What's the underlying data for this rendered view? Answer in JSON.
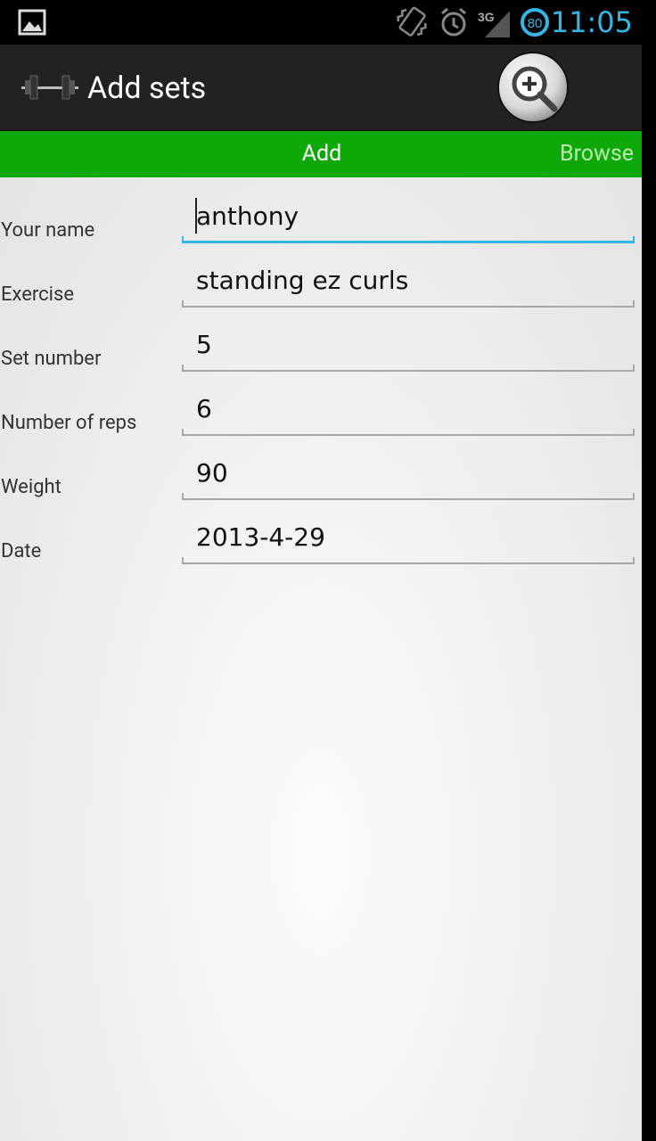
{
  "status_bar": {
    "time": "11:05",
    "network": "3G",
    "battery": "80",
    "icons": [
      "gallery-icon",
      "vibrate-icon",
      "alarm-icon",
      "signal-icon",
      "battery-icon"
    ],
    "accent": "#33b5e5"
  },
  "action_bar": {
    "title": "Add sets",
    "app_icon": "dumbbell-icon",
    "action_icon": "search-zoom-icon"
  },
  "tabs": [
    {
      "label": "Add",
      "selected": true
    },
    {
      "label": "Browse",
      "selected": false
    }
  ],
  "colors": {
    "tab_bar": "#0fa80a",
    "action_bar": "#222222",
    "focus_underline": "#33b5e5"
  },
  "form": {
    "fields": [
      {
        "label": "Your name",
        "value": "anthony",
        "focused": true
      },
      {
        "label": "Exercise",
        "value": "standing ez curls"
      },
      {
        "label": "Set number",
        "value": "5"
      },
      {
        "label": "Number of reps",
        "value": "6"
      },
      {
        "label": "Weight",
        "value": "90"
      },
      {
        "label": "Date",
        "value": "2013-4-29"
      }
    ]
  }
}
